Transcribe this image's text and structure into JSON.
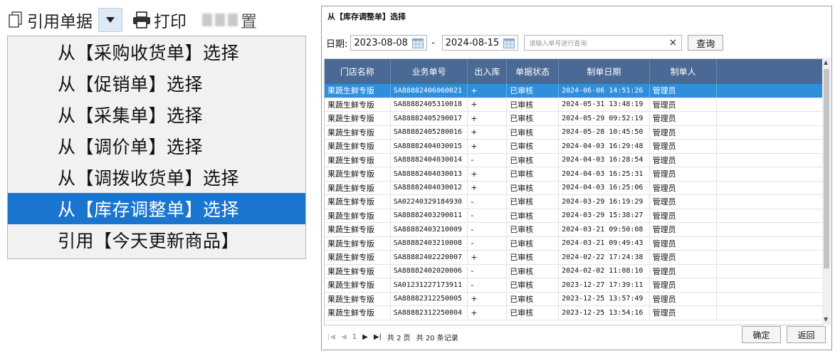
{
  "toolbar": {
    "reference_label": "引用单据",
    "print_label": "打印",
    "blurred_tail": "置"
  },
  "menu": {
    "items": [
      {
        "label": "从【采购收货单】选择",
        "selected": false
      },
      {
        "label": "从【促销单】选择",
        "selected": false
      },
      {
        "label": "从【采集单】选择",
        "selected": false
      },
      {
        "label": "从【调价单】选择",
        "selected": false
      },
      {
        "label": "从【调拨收货单】选择",
        "selected": false
      },
      {
        "label": "从【库存调整单】选择",
        "selected": true
      },
      {
        "label": "引用【今天更新商品】",
        "selected": false
      }
    ],
    "selected_color": "#1a75cf"
  },
  "dialog": {
    "title": "从【库存调整单】选择",
    "date_label": "日期:",
    "date_from": "2023-08-08",
    "date_separator": "-",
    "date_to": "2024-08-15",
    "search_placeholder": "请输入单号进行查询",
    "clear_symbol": "×",
    "query_label": "查询",
    "columns": [
      "门店名称",
      "业务单号",
      "出入库",
      "单据状态",
      "制单日期",
      "制单人",
      ""
    ],
    "rows": [
      [
        "果蔬生鲜专版",
        "SA88882406060021",
        "+",
        "已审核",
        "2024-06-06 14:51:26",
        "管理员"
      ],
      [
        "果蔬生鲜专版",
        "SA88882405310018",
        "+",
        "已审核",
        "2024-05-31 13:48:19",
        "管理员"
      ],
      [
        "果蔬生鲜专版",
        "SA88882405290017",
        "+",
        "已审核",
        "2024-05-29 09:52:19",
        "管理员"
      ],
      [
        "果蔬生鲜专版",
        "SA88882405280016",
        "+",
        "已审核",
        "2024-05-28 10:45:50",
        "管理员"
      ],
      [
        "果蔬生鲜专版",
        "SA88882404030015",
        "+",
        "已审核",
        "2024-04-03 16:29:48",
        "管理员"
      ],
      [
        "果蔬生鲜专版",
        "SA88882404030014",
        "-",
        "已审核",
        "2024-04-03 16:28:54",
        "管理员"
      ],
      [
        "果蔬生鲜专版",
        "SA88882404030013",
        "+",
        "已审核",
        "2024-04-03 16:25:31",
        "管理员"
      ],
      [
        "果蔬生鲜专版",
        "SA88882404030012",
        "+",
        "已审核",
        "2024-04-03 16:25:06",
        "管理员"
      ],
      [
        "果蔬生鲜专版",
        "SA02240329184930",
        "-",
        "已审核",
        "2024-03-29 16:19:29",
        "管理员"
      ],
      [
        "果蔬生鲜专版",
        "SA88882403290011",
        "-",
        "已审核",
        "2024-03-29 15:38:27",
        "管理员"
      ],
      [
        "果蔬生鲜专版",
        "SA88882403210009",
        "-",
        "已审核",
        "2024-03-21 09:50:08",
        "管理员"
      ],
      [
        "果蔬生鲜专版",
        "SA88882403210008",
        "-",
        "已审核",
        "2024-03-21 09:49:43",
        "管理员"
      ],
      [
        "果蔬生鲜专版",
        "SA88882402220007",
        "+",
        "已审核",
        "2024-02-22 17:24:38",
        "管理员"
      ],
      [
        "果蔬生鲜专版",
        "SA88882402020006",
        "-",
        "已审核",
        "2024-02-02 11:08:10",
        "管理员"
      ],
      [
        "果蔬生鲜专版",
        "SA01231227173911",
        "-",
        "已审核",
        "2023-12-27 17:39:11",
        "管理员"
      ],
      [
        "果蔬生鲜专版",
        "SA88882312250005",
        "+",
        "已审核",
        "2023-12-25 13:57:49",
        "管理员"
      ],
      [
        "果蔬生鲜专版",
        "SA88882312250004",
        "+",
        "已审核",
        "2023-12-25 13:54:16",
        "管理员"
      ]
    ],
    "selected_row_index": 0,
    "pager": {
      "first": "|◀",
      "prev": "◀",
      "page": "1",
      "next": "▶",
      "last": "▶|",
      "total_pages": "共 2 页",
      "total_records": "共 20 条记录"
    },
    "ok_label": "确定",
    "back_label": "返回"
  },
  "colors": {
    "header_bg": "#4a6994",
    "selected_row_bg": "#2f8fdc"
  }
}
